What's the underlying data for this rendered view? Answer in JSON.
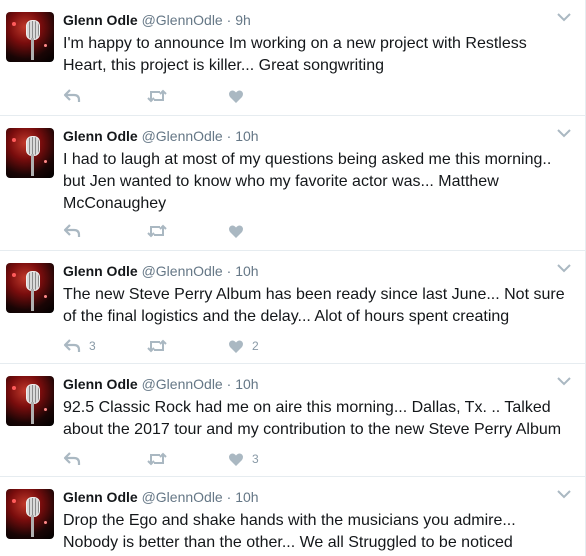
{
  "colors": {
    "icon": "#aab8c2",
    "text": "#14171a",
    "muted": "#657786",
    "divider": "#e6ecf0"
  },
  "tweets": [
    {
      "name": "Glenn Odle",
      "handle": "@GlennOdle",
      "dot": "·",
      "time": "9h",
      "text": "I'm happy to announce Im working on a new project with Restless Heart, this project is killer... Great songwriting",
      "reply_count": "",
      "retweet_count": "",
      "like_count": ""
    },
    {
      "name": "Glenn Odle",
      "handle": "@GlennOdle",
      "dot": "·",
      "time": "10h",
      "text": "I had to laugh at most of my questions being asked me this morning.. but Jen wanted to know who my favorite actor was... Matthew McConaughey",
      "reply_count": "",
      "retweet_count": "",
      "like_count": ""
    },
    {
      "name": "Glenn Odle",
      "handle": "@GlennOdle",
      "dot": "·",
      "time": "10h",
      "text": "The new Steve Perry Album has been ready since last June... Not sure of the final logistics and the delay... Alot of hours spent creating",
      "reply_count": "3",
      "retweet_count": "",
      "like_count": "2"
    },
    {
      "name": "Glenn Odle",
      "handle": "@GlennOdle",
      "dot": "·",
      "time": "10h",
      "text": "92.5 Classic Rock had me on aire this morning... Dallas,  Tx. .. Talked about the 2017 tour and my contribution to the new Steve Perry Album",
      "reply_count": "",
      "retweet_count": "",
      "like_count": "3"
    },
    {
      "name": "Glenn Odle",
      "handle": "@GlennOdle",
      "dot": "·",
      "time": "10h",
      "text": "Drop the Ego and shake hands with the musicians you admire... Nobody is better than the other... We all Struggled to be noticed",
      "reply_count": "",
      "retweet_count": "",
      "like_count": ""
    }
  ]
}
